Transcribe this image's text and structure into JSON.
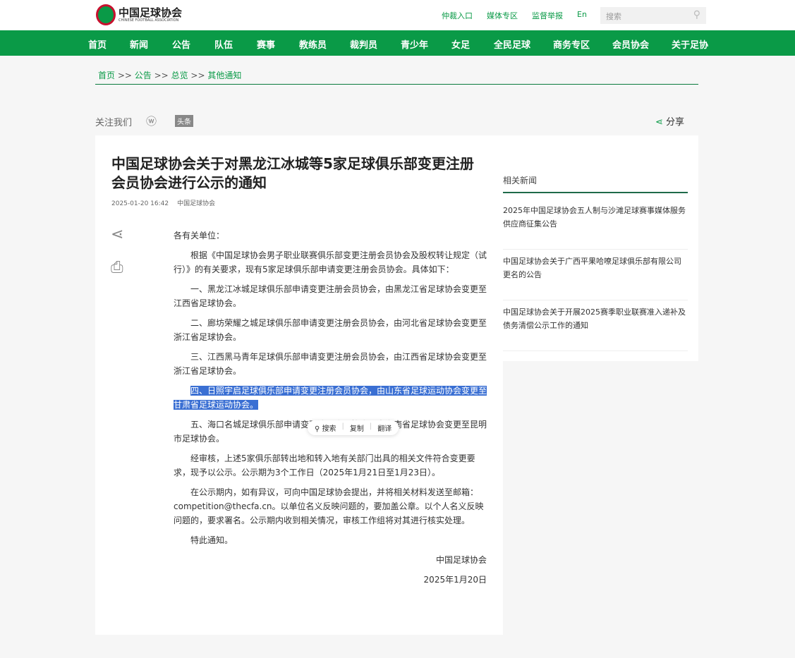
{
  "header": {
    "logo_cn": "中国足球协会",
    "logo_en": "CHINESE FOOTBALL ASSOCIATION",
    "links": [
      "仲裁入口",
      "媒体专区",
      "监督举报",
      "En"
    ],
    "search_placeholder": "搜索"
  },
  "nav": [
    "首页",
    "新闻",
    "公告",
    "队伍",
    "赛事",
    "教练员",
    "裁判员",
    "青少年",
    "女足",
    "全民足球",
    "商务专区",
    "会员协会",
    "关于足协"
  ],
  "breadcrumb": [
    "首页",
    "公告",
    "总览",
    "其他通知"
  ],
  "breadcrumb_sep": ">>",
  "follow": {
    "label": "关注我们",
    "toutiao": "头条",
    "share": "分享"
  },
  "article": {
    "title": "中国足球协会关于对黑龙江冰城等5家足球俱乐部变更注册会员协会进行公示的通知",
    "date": "2025-01-20 16:42",
    "source": "中国足球协会",
    "salutation": "各有关单位：",
    "paragraphs": [
      "根据《中国足球协会男子职业联赛俱乐部变更注册会员协会及股权转让规定（试行）》的有关要求，现有5家足球俱乐部申请变更注册会员协会。具体如下：",
      "一、黑龙江冰城足球俱乐部申请变更注册会员协会，由黑龙江省足球协会变更至江西省足球协会。",
      "二、廊坊荣耀之城足球俱乐部申请变更注册会员协会，由河北省足球协会变更至浙江省足球协会。",
      "三、江西黑马青年足球俱乐部申请变更注册会员协会，由江西省足球协会变更至浙江省足球协会。",
      "四、日照宇启足球俱乐部申请变更注册会员协会，由山东省足球运动协会变更至甘肃省足球运动协会。",
      "五、海口名城足球俱乐部申请变更注册会员协会，由海南省足球协会变更至昆明市足球协会。",
      "经审核，上述5家俱乐部转出地和转入地有关部门出具的相关文件符合变更要求，现予以公示。公示期为3个工作日（2025年1月21日至1月23日）。",
      "在公示期内，如有异议，可向中国足球协会提出，并将相关材料发送至邮箱：competition@thecfa.cn。以单位名义反映问题的，要加盖公章。以个人名义反映问题的，要求署名。公示期内收到相关情况，审核工作组将对其进行核实处理。",
      "特此通知。"
    ],
    "signature": "中国足球协会",
    "sign_date": "2025年1月20日"
  },
  "popup": {
    "search": "搜索",
    "copy": "复制",
    "translate": "翻译"
  },
  "related": {
    "title": "相关新闻",
    "items": [
      "2025年中国足球协会五人制与沙滩足球赛事媒体服务供应商征集公告",
      "中国足球协会关于广西平果哈嘹足球俱乐部有限公司更名的公告",
      "中国足球协会关于开展2025赛季职业联赛准入递补及债务清偿公示工作的通知"
    ]
  }
}
